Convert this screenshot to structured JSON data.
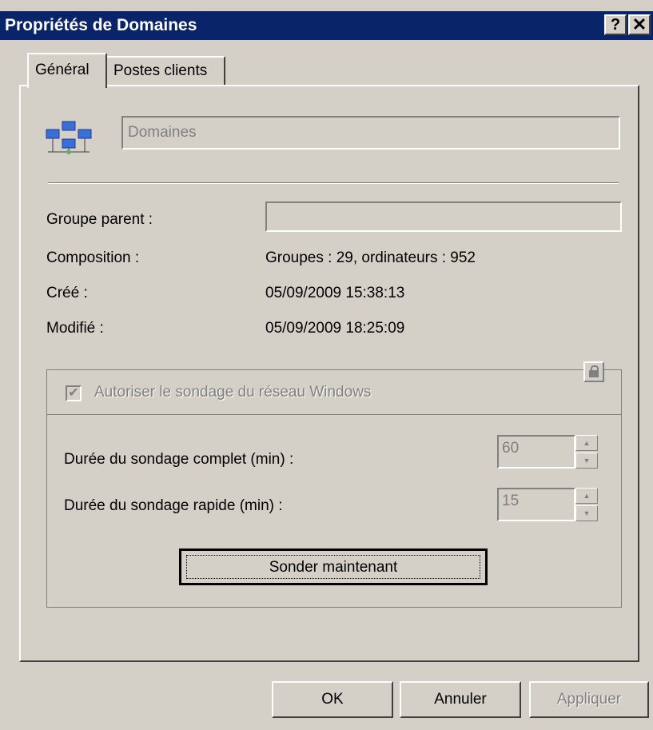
{
  "window": {
    "title": "Propriétés de Domaines",
    "help_label": "?",
    "close_label": "✕"
  },
  "tabs": [
    {
      "label": "Général",
      "active": true
    },
    {
      "label": "Postes clients",
      "active": false
    }
  ],
  "general": {
    "name_value": "Domaines",
    "parent_label": "Groupe parent :",
    "parent_value": "",
    "composition_label": "Composition :",
    "composition_value": "Groupes : 29, ordinateurs : 952",
    "created_label": "Créé :",
    "created_value": "05/09/2009 15:38:13",
    "modified_label": "Modifié :",
    "modified_value": "05/09/2009 18:25:09"
  },
  "polling": {
    "checkbox_label": "Autoriser le sondage du réseau Windows",
    "checkbox_checked": true,
    "full_label": "Durée du sondage complet (min) :",
    "full_value": "60",
    "quick_label": "Durée du sondage rapide (min) :",
    "quick_value": "15",
    "poll_now_label": "Sonder maintenant"
  },
  "buttons": {
    "ok": "OK",
    "cancel": "Annuler",
    "apply": "Appliquer"
  },
  "colors": {
    "titlebar": "#0a246a",
    "face": "#d4d0c8"
  }
}
